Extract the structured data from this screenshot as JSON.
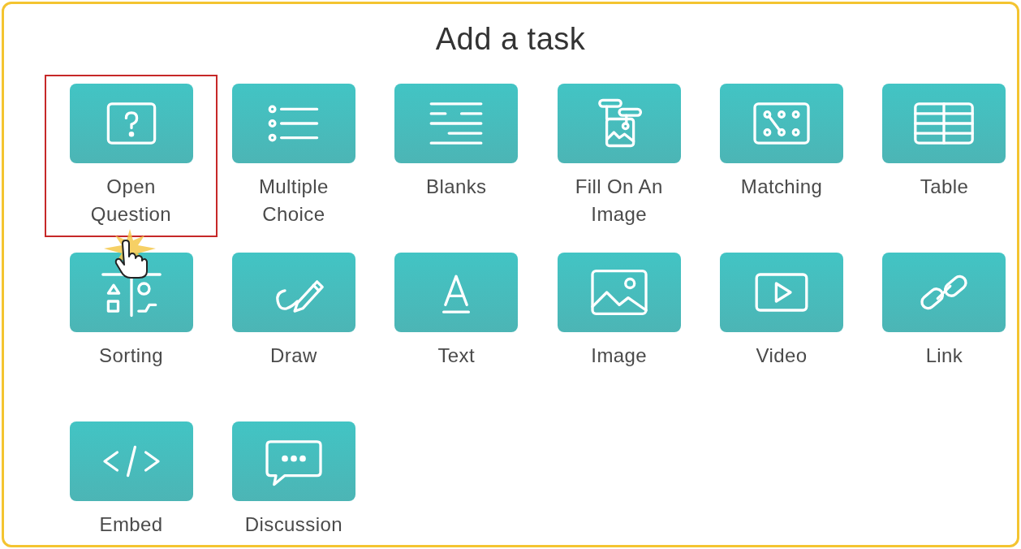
{
  "title": "Add a task",
  "tasks": [
    {
      "label": "Open Question",
      "kind": "question",
      "selected": true
    },
    {
      "label": "Multiple Choice",
      "kind": "choice",
      "selected": false
    },
    {
      "label": "Blanks",
      "kind": "blanks",
      "selected": false
    },
    {
      "label": "Fill On An Image",
      "kind": "fill-image",
      "selected": false
    },
    {
      "label": "Matching",
      "kind": "matching",
      "selected": false
    },
    {
      "label": "Table",
      "kind": "table",
      "selected": false
    },
    {
      "label": "Sorting",
      "kind": "sorting",
      "selected": false
    },
    {
      "label": "Draw",
      "kind": "draw",
      "selected": false
    },
    {
      "label": "Text",
      "kind": "text",
      "selected": false
    },
    {
      "label": "Image",
      "kind": "image",
      "selected": false
    },
    {
      "label": "Video",
      "kind": "video",
      "selected": false
    },
    {
      "label": "Link",
      "kind": "link",
      "selected": false
    },
    {
      "label": "Embed",
      "kind": "embed",
      "selected": false
    },
    {
      "label": "Discussion",
      "kind": "discussion",
      "selected": false
    }
  ]
}
